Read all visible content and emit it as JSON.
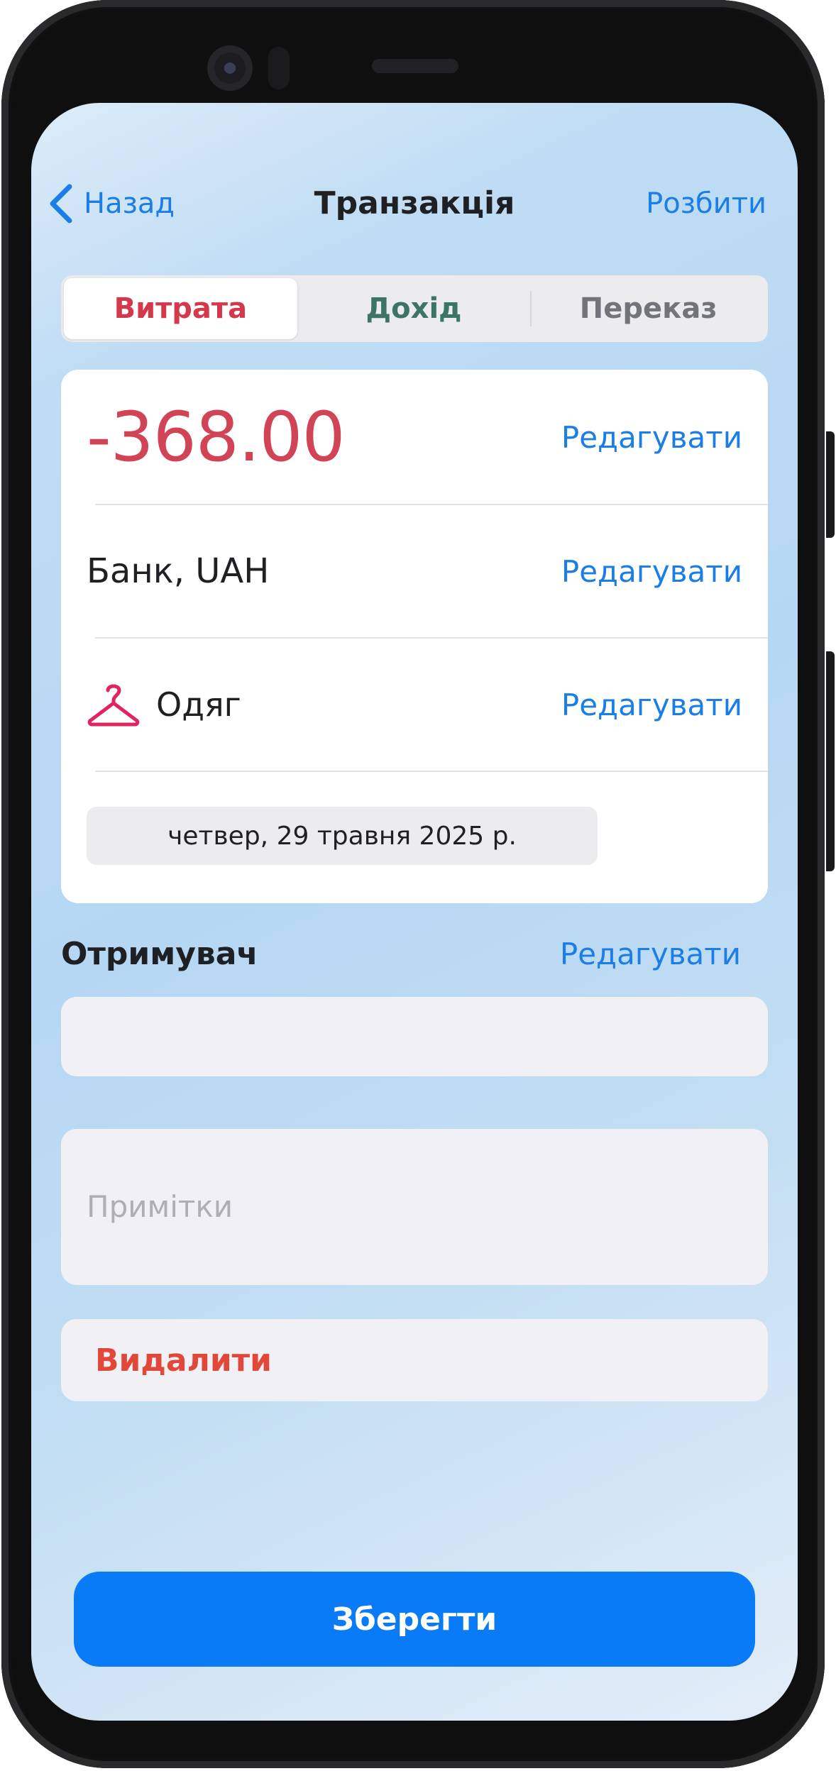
{
  "header": {
    "back_label": "Назад",
    "title": "Транзакція",
    "split_label": "Розбити"
  },
  "type_tabs": [
    {
      "label": "Витрата",
      "active": true
    },
    {
      "label": "Дохід",
      "active": false
    },
    {
      "label": "Переказ",
      "active": false
    }
  ],
  "transaction": {
    "amount": "-368.00",
    "account": "Банк, UAH",
    "category": "Одяг",
    "category_icon": "clothes-hanger-icon",
    "date": "четвер, 29 травня 2025 р.",
    "edit_label": "Редагувати"
  },
  "payee": {
    "label": "Отримувач",
    "edit_label": "Редагувати",
    "value": ""
  },
  "notes": {
    "placeholder": "Примітки",
    "value": ""
  },
  "actions": {
    "delete_label": "Видалити",
    "save_label": "Зберегти"
  },
  "colors": {
    "accent": "#1a7ee6",
    "expense": "#d14456",
    "income": "#3d7565",
    "delete": "#e2483a",
    "save_button": "#0a7bf7",
    "category_icon": "#e0245e"
  }
}
